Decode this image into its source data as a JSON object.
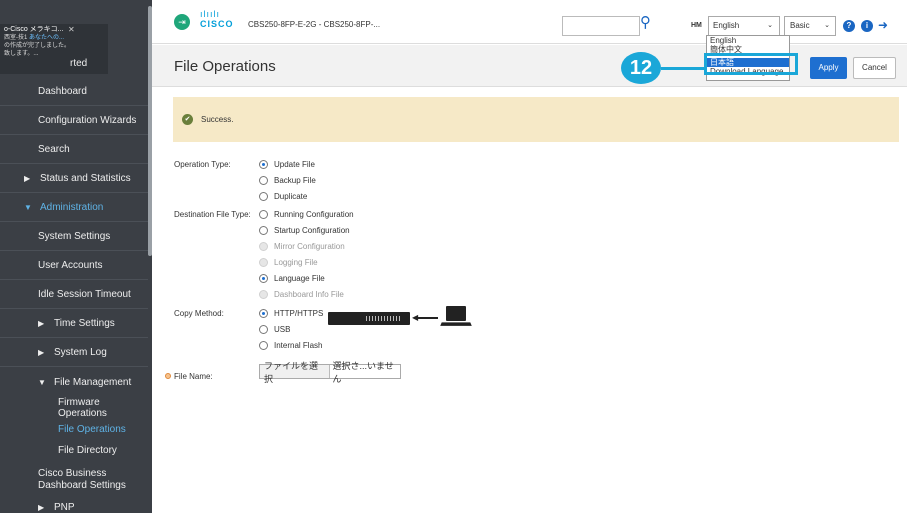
{
  "notification": {
    "title": "o-Cisco メラキコ...",
    "line1_prefix": "西室-技1 ",
    "line1_highlight": "あなたへの...",
    "line2": "の作成が完了しました。",
    "line3": "致します。..."
  },
  "sidebar": {
    "getting_started": "rted",
    "items": [
      {
        "label": "Dashboard"
      },
      {
        "label": "Configuration Wizards"
      },
      {
        "label": "Search"
      },
      {
        "label": "Status and Statistics"
      },
      {
        "label": "Administration"
      },
      {
        "label": "System Settings"
      },
      {
        "label": "User Accounts"
      },
      {
        "label": "Idle Session Timeout"
      },
      {
        "label": "Time Settings"
      },
      {
        "label": "System Log"
      },
      {
        "label": "File Management"
      }
    ],
    "subitems": [
      {
        "label": "Firmware Operations"
      },
      {
        "label": "File Operations"
      },
      {
        "label": "File Directory"
      }
    ],
    "bottom_item": "Cisco Business\nDashboard Settings",
    "next_item": "PNP"
  },
  "header": {
    "device_title": "CBS250-8FP-E-2G - CBS250-8FP-...",
    "cisco_word": "CISCO",
    "user": "HM",
    "language": "English",
    "mode": "Basic",
    "language_options": [
      "English",
      "簡体中文",
      "日本語",
      "Download Language"
    ]
  },
  "page": {
    "title": "File Operations",
    "apply": "Apply",
    "cancel": "Cancel"
  },
  "annotation": {
    "step": "12"
  },
  "success": {
    "text": "Success."
  },
  "form": {
    "operation_type_label": "Operation Type:",
    "operation_types": [
      {
        "label": "Update File",
        "checked": true,
        "disabled": false
      },
      {
        "label": "Backup File",
        "checked": false,
        "disabled": false
      },
      {
        "label": "Duplicate",
        "checked": false,
        "disabled": false
      }
    ],
    "dest_file_type_label": "Destination File Type:",
    "dest_file_types": [
      {
        "label": "Running Configuration",
        "checked": false,
        "disabled": false
      },
      {
        "label": "Startup Configuration",
        "checked": false,
        "disabled": false
      },
      {
        "label": "Mirror Configuration",
        "checked": false,
        "disabled": true
      },
      {
        "label": "Logging File",
        "checked": false,
        "disabled": true
      },
      {
        "label": "Language File",
        "checked": true,
        "disabled": false
      },
      {
        "label": "Dashboard Info File",
        "checked": false,
        "disabled": true
      }
    ],
    "copy_method_label": "Copy Method:",
    "copy_methods": [
      {
        "label": "HTTP/HTTPS",
        "checked": true,
        "disabled": false
      },
      {
        "label": "USB",
        "checked": false,
        "disabled": false
      },
      {
        "label": "Internal Flash",
        "checked": false,
        "disabled": false
      }
    ],
    "file_name_label": "File Name:",
    "choose_file": "ファイルを選択",
    "no_file": "選択さ...いません"
  },
  "colors": {
    "sidebar_bg": "#3b3f45",
    "accent": "#1e6fd0",
    "annotation": "#1aa7d8",
    "success_bg": "#f6e9c7"
  }
}
